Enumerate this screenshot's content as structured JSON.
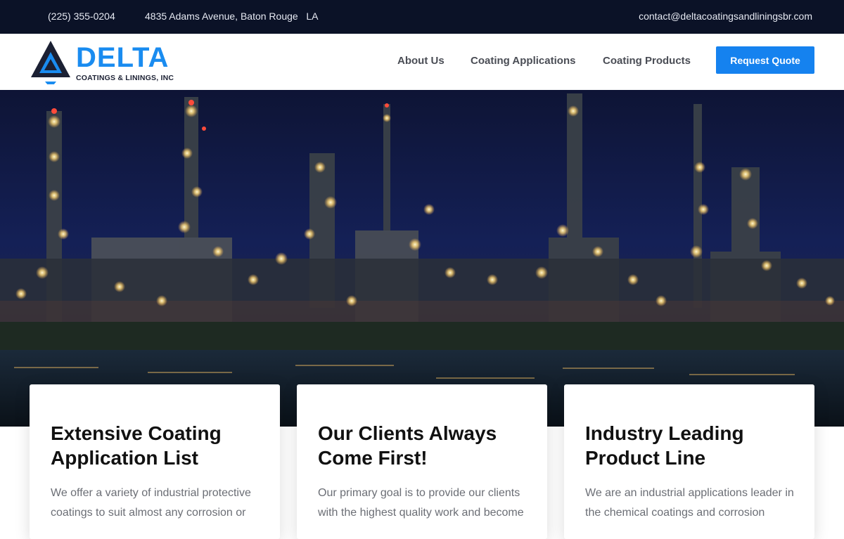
{
  "topbar": {
    "phone": "(225) 355-0204",
    "address": "4835 Adams Avenue, Baton Rouge   LA",
    "email": "contact@deltacoatingsandliningsbr.com"
  },
  "brand": {
    "name": "DELTA",
    "tagline": "COATINGS & LININGS, INC",
    "primary_color": "#1582ef",
    "dark_color": "#0b1227"
  },
  "nav": {
    "items": [
      {
        "label": "About Us"
      },
      {
        "label": "Coating Applications"
      },
      {
        "label": "Coating Products"
      }
    ],
    "cta_label": "Request Quote"
  },
  "hero": {
    "image": "night-refinery-photo"
  },
  "cards": [
    {
      "title": "Extensive Coating Application List",
      "text": "We offer a variety of industrial protective coatings to suit almost any corrosion or"
    },
    {
      "title": "Our Clients Always Come First!",
      "text": "Our primary goal is to provide our clients with the highest quality work and become"
    },
    {
      "title": "Industry Leading Product Line",
      "text": "We are an industrial applications leader in the chemical coatings and corrosion"
    }
  ]
}
